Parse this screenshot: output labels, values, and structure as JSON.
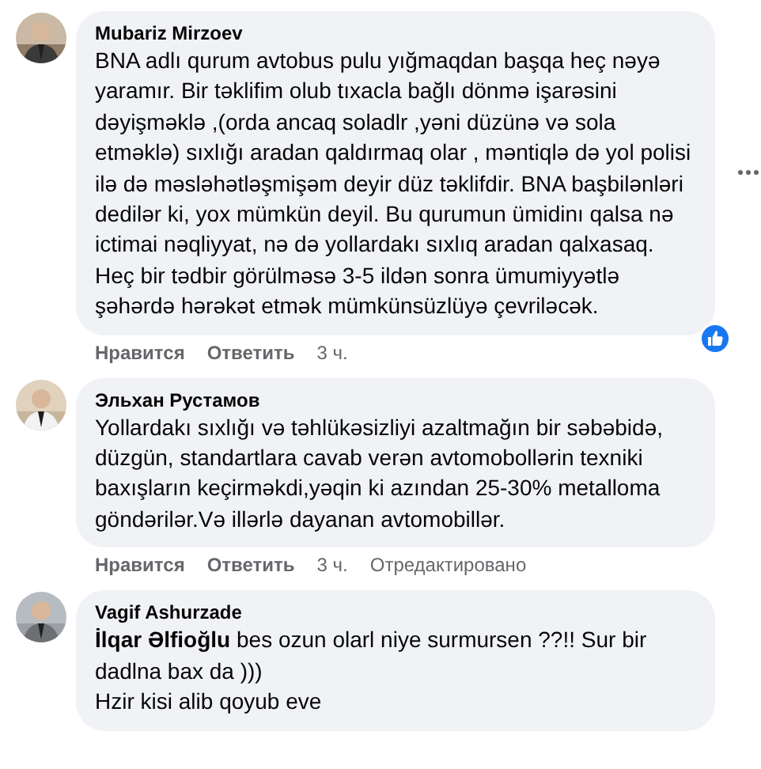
{
  "comments": [
    {
      "author": "Mubariz Mirzoev",
      "text": "BNA adlı qurum avtobus pulu yığmaqdan başqa heç nəyə yaramır. Bir təklifim olub tıxacla bağlı dönmə işarəsini dəyişməklə ,(orda ancaq soladlr ,yəni düzünə və sola etməklə) sıxlığı aradan qaldırmaq olar , məntiqlə də yol polisi ilə də məsləhətləşmişəm deyir düz təklifdir. BNA başbilənləri dedilər ki, yox mümkün deyil. Bu qurumun ümidinı qalsa nə ictimai nəqliyyat, nə də yollardakı sıxlıq aradan qalxasaq. Heç bir tədbir görülməsə 3-5 ildən sonra ümumiyyətlə şəhərdə hərəkət etmək mümkünsüzlüyə çevriləcək.",
      "liked": true,
      "more_menu": true,
      "actions": {
        "like": "Нравится",
        "reply": "Ответить",
        "time": "3 ч."
      }
    },
    {
      "author": "Эльхан Рустамов",
      "text": "Yollardakı sıxlığı və təhlükəsizliyi azaltmağın bir səbəbidə, düzgün, standartlara cavab verən avtomobollərin texniki baxışların keçirməkdi,yəqin ki azından 25-30% metalloma göndərilər.Və illərlə dayanan avtomobillər.",
      "actions": {
        "like": "Нравится",
        "reply": "Ответить",
        "time": "3 ч.",
        "edited": "Отредактировано"
      }
    },
    {
      "author": "Vagif Ashurzade",
      "text": "**İlqar Əlfioğlu** bes ozun olarl niye surmursen ??!! Sur bir dadlna bax da )))\nHzir kisi alib qoyub eve"
    }
  ]
}
